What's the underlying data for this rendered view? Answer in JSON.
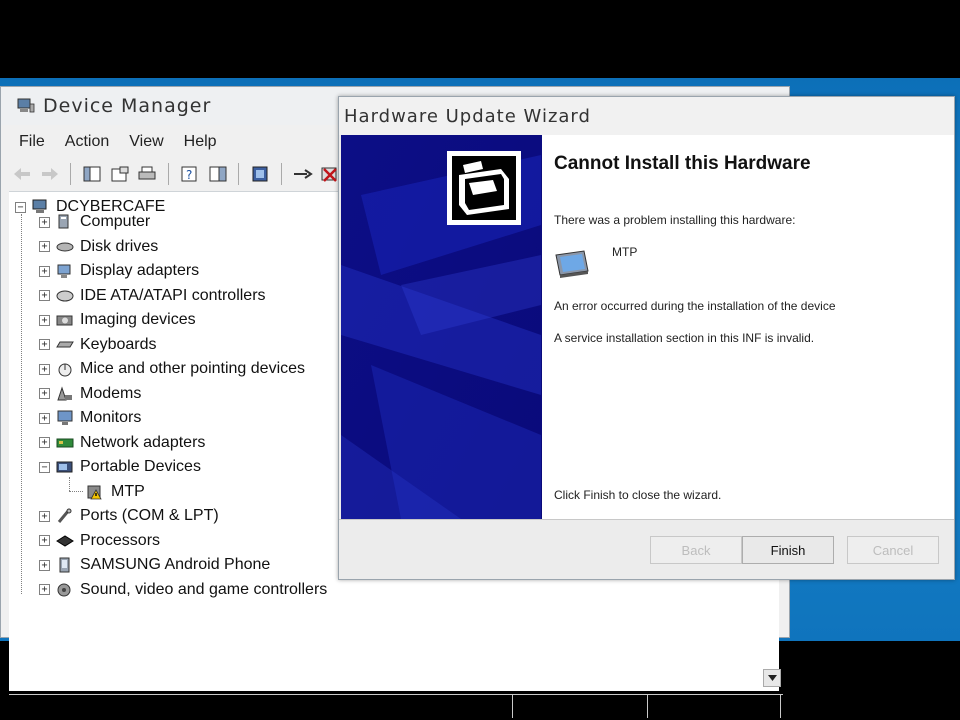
{
  "device_manager": {
    "title": "Device Manager",
    "menu": [
      "File",
      "Action",
      "View",
      "Help"
    ],
    "toolbar_icons": [
      "back-arrow-icon",
      "forward-arrow-icon",
      "show-hide-tree-icon",
      "properties-icon",
      "print-icon",
      "help-icon",
      "show-hide-console-icon",
      "scan-hardware-icon",
      "update-driver-icon",
      "disable-device-icon"
    ],
    "tree": {
      "root": "DCYBERCAFE",
      "items": [
        {
          "label": "Computer",
          "icon": "computer-icon",
          "expander": "+"
        },
        {
          "label": "Disk drives",
          "icon": "disk-drive-icon",
          "expander": "+"
        },
        {
          "label": "Display adapters",
          "icon": "display-adapter-icon",
          "expander": "+"
        },
        {
          "label": "IDE ATA/ATAPI controllers",
          "icon": "ide-controller-icon",
          "expander": "+"
        },
        {
          "label": "Imaging devices",
          "icon": "camera-icon",
          "expander": "+"
        },
        {
          "label": "Keyboards",
          "icon": "keyboard-icon",
          "expander": "+"
        },
        {
          "label": "Mice and other pointing devices",
          "icon": "mouse-icon",
          "expander": "+"
        },
        {
          "label": "Modems",
          "icon": "modem-icon",
          "expander": "+"
        },
        {
          "label": "Monitors",
          "icon": "monitor-icon",
          "expander": "+"
        },
        {
          "label": "Network adapters",
          "icon": "network-adapter-icon",
          "expander": "+"
        },
        {
          "label": "Portable Devices",
          "icon": "portable-device-icon",
          "expander": "-"
        },
        {
          "label": "Ports (COM & LPT)",
          "icon": "port-icon",
          "expander": "+"
        },
        {
          "label": "Processors",
          "icon": "processor-icon",
          "expander": "+"
        },
        {
          "label": "SAMSUNG Android Phone",
          "icon": "phone-icon",
          "expander": "+"
        },
        {
          "label": "Sound, video and game controllers",
          "icon": "sound-icon",
          "expander": "+"
        }
      ],
      "child": {
        "label": "MTP",
        "icon": "warning-device-icon"
      }
    }
  },
  "wizard": {
    "title": "Hardware Update Wizard",
    "heading": "Cannot Install this Hardware",
    "problem_text": "There was a problem installing this hardware:",
    "device_name": "MTP",
    "error_text": "An error occurred during the installation of the device",
    "detail_text": "A service installation section in this INF is invalid.",
    "finish_hint": "Click Finish to close the wizard.",
    "buttons": {
      "back": "Back",
      "finish": "Finish",
      "cancel": "Cancel"
    }
  },
  "colors": {
    "desktop": "#1a86cc",
    "wizard_banner": "#0b0d8a"
  }
}
